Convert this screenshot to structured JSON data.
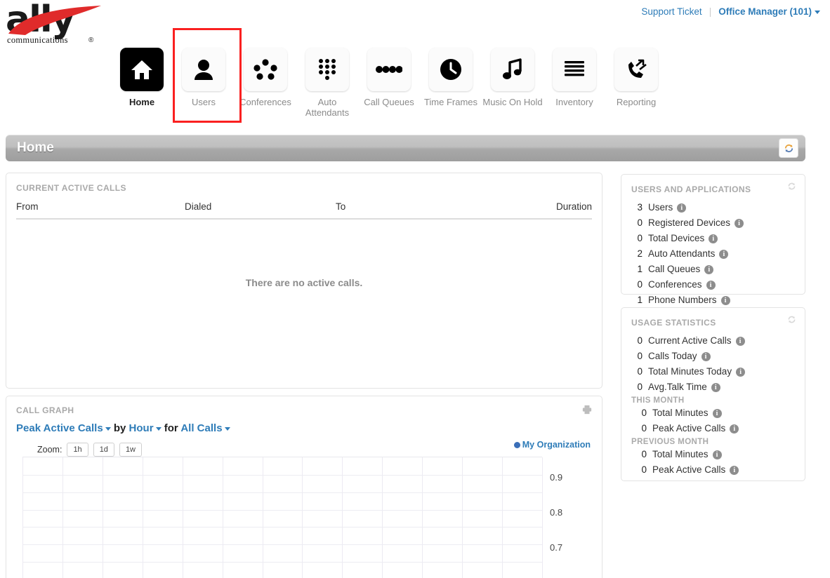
{
  "header": {
    "logo_text": "ally",
    "logo_sub": "communications",
    "logo_reg": "®",
    "support_link": "Support Ticket",
    "user_menu": "Office Manager (101)"
  },
  "nav": {
    "items": [
      {
        "label": "Home",
        "icon": "home-icon",
        "active": true
      },
      {
        "label": "Users",
        "icon": "user-icon",
        "active": false
      },
      {
        "label": "Conferences",
        "icon": "conferences-icon",
        "active": false
      },
      {
        "label": "Auto Attendants",
        "icon": "dialpad-icon",
        "active": false
      },
      {
        "label": "Call Queues",
        "icon": "dots-icon",
        "active": false
      },
      {
        "label": "Time Frames",
        "icon": "clock-icon",
        "active": false
      },
      {
        "label": "Music On Hold",
        "icon": "music-note-icon",
        "active": false
      },
      {
        "label": "Inventory",
        "icon": "list-lines-icon",
        "active": false
      },
      {
        "label": "Reporting",
        "icon": "phone-arrows-icon",
        "active": false
      }
    ],
    "highlight_color": "#fa2020"
  },
  "titlebar": {
    "title": "Home",
    "refresh_icon": "refresh-icon"
  },
  "active_calls": {
    "panel_title": "CURRENT ACTIVE CALLS",
    "columns": [
      "From",
      "Dialed",
      "To",
      "Duration"
    ],
    "empty_message": "There are no active calls.",
    "rows": []
  },
  "call_graph": {
    "panel_title": "CALL GRAPH",
    "printer_icon": "printer-icon",
    "metric": "Peak Active Calls",
    "by_word": "by",
    "interval": "Hour",
    "for_word": "for",
    "filter": "All Calls",
    "zoom_label": "Zoom:",
    "zoom_buttons": [
      "1h",
      "1d",
      "1w"
    ],
    "legend": "My Organization",
    "legend_color": "#3a6fb8"
  },
  "users_apps": {
    "panel_title": "USERS AND APPLICATIONS",
    "refresh_icon": "refresh-icon",
    "rows": [
      {
        "count": "3",
        "label": "Users"
      },
      {
        "count": "0",
        "label": "Registered Devices"
      },
      {
        "count": "0",
        "label": "Total Devices"
      },
      {
        "count": "2",
        "label": "Auto Attendants"
      },
      {
        "count": "1",
        "label": "Call Queues"
      },
      {
        "count": "0",
        "label": "Conferences"
      },
      {
        "count": "1",
        "label": "Phone Numbers"
      }
    ]
  },
  "usage_stats": {
    "panel_title": "USAGE STATISTICS",
    "refresh_icon": "refresh-icon",
    "rows": [
      {
        "count": "0",
        "label": "Current Active Calls"
      },
      {
        "count": "0",
        "label": "Calls Today"
      },
      {
        "count": "0",
        "label": "Total Minutes Today"
      },
      {
        "count": "0",
        "label": "Avg.Talk Time"
      }
    ],
    "this_month_head": "THIS MONTH",
    "this_month": [
      {
        "count": "0",
        "label": "Total Minutes"
      },
      {
        "count": "0",
        "label": "Peak Active Calls"
      }
    ],
    "previous_month_head": "PREVIOUS MONTH",
    "previous_month": [
      {
        "count": "0",
        "label": "Total Minutes"
      },
      {
        "count": "0",
        "label": "Peak Active Calls"
      }
    ]
  },
  "chart_data": {
    "type": "line",
    "title": "CALL GRAPH",
    "subtitle": "Peak Active Calls by Hour for All Calls",
    "xlabel": "",
    "ylabel": "",
    "series": [
      {
        "name": "My Organization",
        "color": "#3a6fb8",
        "values": []
      }
    ],
    "x": [],
    "y_ticks": [
      "0.9",
      "0.8",
      "0.7"
    ],
    "y_tick_values": [
      0.9,
      0.8,
      0.7
    ],
    "ylim": [
      0.6,
      1.0
    ],
    "grid": true,
    "grid_columns": 13,
    "grid_rows": 7,
    "legend_position": "top-right",
    "note": "No data plotted - empty grid shown; chart is clipped at the bottom of the viewport"
  }
}
